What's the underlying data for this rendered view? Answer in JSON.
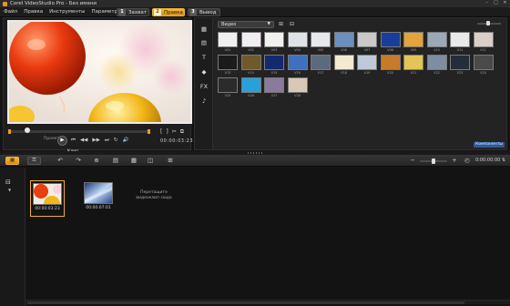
{
  "window": {
    "title": "Corel VideoStudio Pro - Без имени",
    "controls": [
      "–",
      "□",
      "✕"
    ]
  },
  "menu": [
    "Файл",
    "Правка",
    "Инструменты",
    "Параметры"
  ],
  "steps": [
    {
      "num": "1",
      "label": "Захват",
      "active": false
    },
    {
      "num": "2",
      "label": "Правка",
      "active": true
    },
    {
      "num": "3",
      "label": "Вывод",
      "active": false
    }
  ],
  "player": {
    "project_label": "Проект",
    "clip_label": "Клип",
    "timecode": "00:00:03:23",
    "transport_glyphs": [
      "⏮",
      "◀◀",
      "▶▶",
      "⏭",
      "↻",
      "🔊"
    ],
    "trim_glyphs": [
      "[",
      "]",
      "✂",
      "⧉"
    ]
  },
  "library": {
    "category": "Видео",
    "link_label": "Компоненты",
    "side_tools": [
      "▦",
      "▤",
      "T",
      "◆",
      "FX",
      "♪"
    ],
    "items": [
      {
        "label": "V01",
        "color": "#f0f0f0"
      },
      {
        "label": "V02",
        "color": "#f2eef4"
      },
      {
        "label": "V03",
        "color": "#f1f1ef"
      },
      {
        "label": "V04",
        "color": "#dfe3e8"
      },
      {
        "label": "V05",
        "color": "#e6e9ee"
      },
      {
        "label": "V06",
        "color": "#6b8fbf"
      },
      {
        "label": "V07",
        "color": "#c9c9c9"
      },
      {
        "label": "V08",
        "color": "#1a3c9a"
      },
      {
        "label": "V09",
        "color": "#e3a43a"
      },
      {
        "label": "V10",
        "color": "#9aa8b8"
      },
      {
        "label": "V11",
        "color": "#e9e9e9"
      },
      {
        "label": "V12",
        "color": "#d9cfc6"
      },
      {
        "label": "V13",
        "color": "#1b1b1b"
      },
      {
        "label": "V14",
        "color": "#6e5a2a"
      },
      {
        "label": "V15",
        "color": "#142a6e"
      },
      {
        "label": "V16",
        "color": "#3f6fbf"
      },
      {
        "label": "V17",
        "color": "#5a6b7c"
      },
      {
        "label": "V18",
        "color": "#f2ead2"
      },
      {
        "label": "V19",
        "color": "#bfc9d9"
      },
      {
        "label": "V20",
        "color": "#c87a2a"
      },
      {
        "label": "V21",
        "color": "#e4c454"
      },
      {
        "label": "V22",
        "color": "#7d8ea3"
      },
      {
        "label": "V23",
        "color": "#262d3a"
      },
      {
        "label": "V24",
        "color": "#4a4a4a"
      },
      {
        "label": "V25",
        "color": "#2b2b2b"
      },
      {
        "label": "V26",
        "color": "#2aa0d9"
      },
      {
        "label": "V27",
        "color": "#8a7a9e"
      },
      {
        "label": "V28",
        "color": "#d8c8b8"
      }
    ]
  },
  "timeline": {
    "duration": "0:00:00:00 ⇅",
    "tools": [
      "↶",
      "↷",
      "⊕",
      "▤",
      "▦",
      "◫",
      "⊞"
    ],
    "clips": [
      {
        "time": "00:00:03:23",
        "selected": true
      },
      {
        "time": "00:00:07:01",
        "selected": false
      }
    ],
    "drop_hint": "Перетащите видеоклип сюда"
  }
}
